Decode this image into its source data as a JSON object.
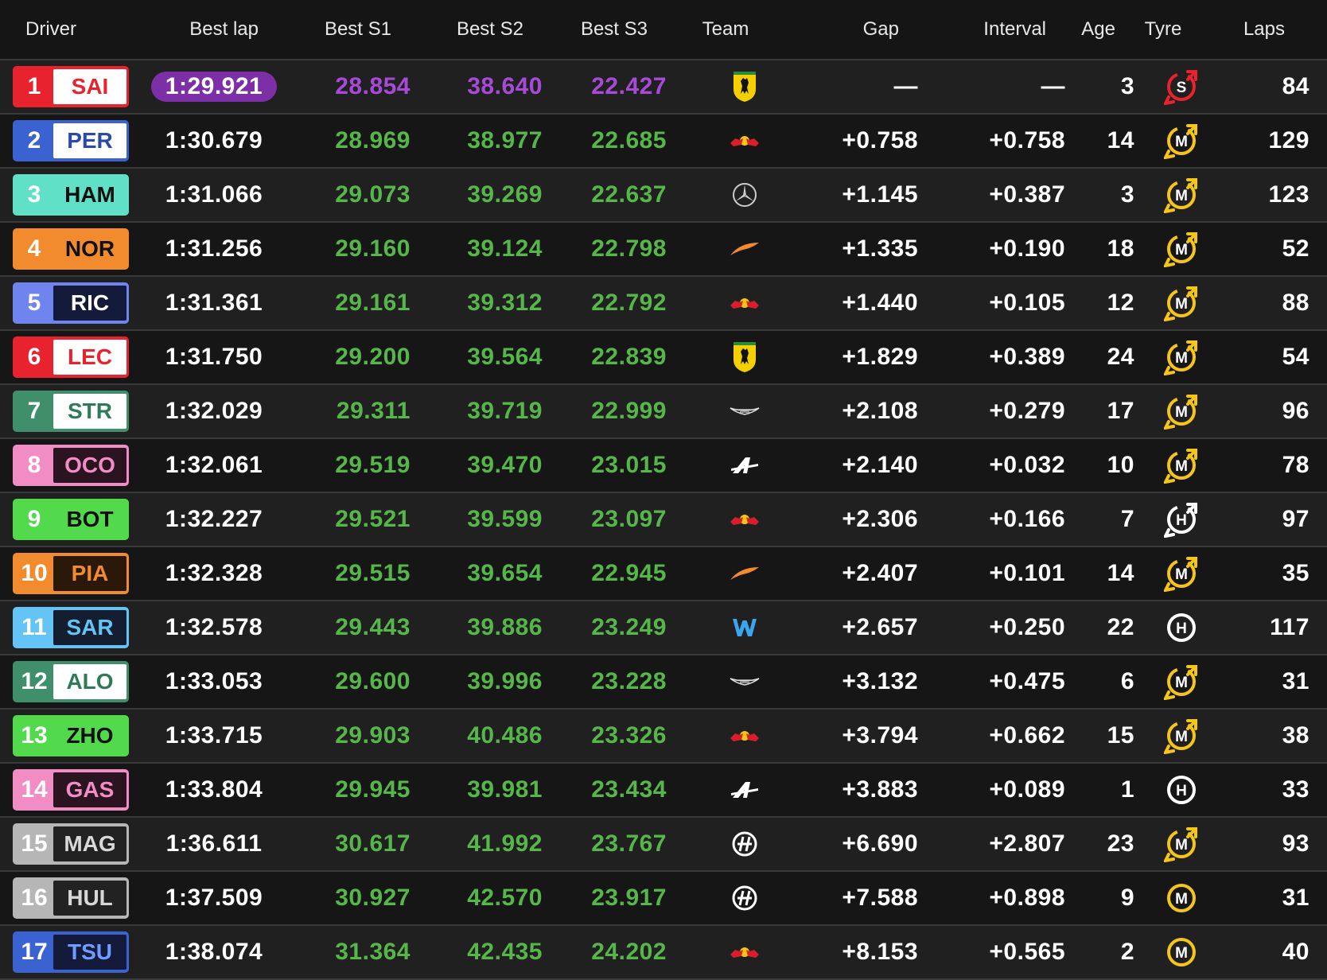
{
  "headers": {
    "driver": "Driver",
    "best_lap": "Best lap",
    "best_s1": "Best S1",
    "best_s2": "Best S2",
    "best_s3": "Best S3",
    "team": "Team",
    "gap": "Gap",
    "interval": "Interval",
    "age": "Age",
    "tyre": "Tyre",
    "laps": "Laps"
  },
  "colors": {
    "purple_sector": "#a84ad8",
    "green_sector": "#56b64a",
    "fastest_lap_pill": "#7d2fa8",
    "soft_tyre": "#e8232d",
    "medium_tyre": "#f5c518",
    "hard_tyre": "#ffffff"
  },
  "rows": [
    {
      "pos": "1",
      "code": "SAI",
      "team": "ferrari-icon",
      "team_color": "#e8232d",
      "code_bg": "#ffffff",
      "code_color": "#e8232d",
      "best_lap": "1:29.921",
      "fastest": true,
      "s1": "28.854",
      "s2": "38.640",
      "s3": "22.427",
      "s1_purple": true,
      "s2_purple": true,
      "s3_purple": true,
      "gap": "—",
      "interval": "—",
      "age": "3",
      "tyre": "S",
      "tyre_icon": "soft-tyre-icon",
      "laps": "84"
    },
    {
      "pos": "2",
      "code": "PER",
      "team": "red-bull-icon",
      "team_color": "#3a62d0",
      "code_bg": "#ffffff",
      "code_color": "#2a4aa8",
      "best_lap": "1:30.679",
      "fastest": false,
      "s1": "28.969",
      "s2": "38.977",
      "s3": "22.685",
      "gap": "+0.758",
      "interval": "+0.758",
      "age": "14",
      "tyre": "M",
      "tyre_icon": "medium-tyre-icon",
      "laps": "129"
    },
    {
      "pos": "3",
      "code": "HAM",
      "team": "mercedes-icon",
      "team_color": "#5fe0c7",
      "code_bg": "#5fe0c7",
      "code_color": "#101010",
      "best_lap": "1:31.066",
      "fastest": false,
      "s1": "29.073",
      "s2": "39.269",
      "s3": "22.637",
      "gap": "+1.145",
      "interval": "+0.387",
      "age": "3",
      "tyre": "M",
      "tyre_icon": "medium-tyre-icon",
      "laps": "123"
    },
    {
      "pos": "4",
      "code": "NOR",
      "team": "mclaren-icon",
      "team_color": "#f28a2e",
      "code_bg": "#f28a2e",
      "code_color": "#101010",
      "best_lap": "1:31.256",
      "fastest": false,
      "s1": "29.160",
      "s2": "39.124",
      "s3": "22.798",
      "gap": "+1.335",
      "interval": "+0.190",
      "age": "18",
      "tyre": "M",
      "tyre_icon": "medium-tyre-icon",
      "laps": "52"
    },
    {
      "pos": "5",
      "code": "RIC",
      "team": "red-bull-icon",
      "team_color": "#6f84ee",
      "code_bg": "#141a3a",
      "code_color": "#ffffff",
      "best_lap": "1:31.361",
      "fastest": false,
      "s1": "29.161",
      "s2": "39.312",
      "s3": "22.792",
      "gap": "+1.440",
      "interval": "+0.105",
      "age": "12",
      "tyre": "M",
      "tyre_icon": "medium-tyre-icon",
      "laps": "88"
    },
    {
      "pos": "6",
      "code": "LEC",
      "team": "ferrari-icon",
      "team_color": "#e8232d",
      "code_bg": "#ffffff",
      "code_color": "#e8232d",
      "best_lap": "1:31.750",
      "fastest": false,
      "s1": "29.200",
      "s2": "39.564",
      "s3": "22.839",
      "gap": "+1.829",
      "interval": "+0.389",
      "age": "24",
      "tyre": "M",
      "tyre_icon": "medium-tyre-icon",
      "laps": "54"
    },
    {
      "pos": "7",
      "code": "STR",
      "team": "aston-martin-icon",
      "team_color": "#3f8f6a",
      "code_bg": "#ffffff",
      "code_color": "#2f7a57",
      "best_lap": "1:32.029",
      "fastest": false,
      "s1": "29.311",
      "s2": "39.719",
      "s3": "22.999",
      "gap": "+2.108",
      "interval": "+0.279",
      "age": "17",
      "tyre": "M",
      "tyre_icon": "medium-tyre-icon",
      "laps": "96"
    },
    {
      "pos": "8",
      "code": "OCO",
      "team": "alpine-icon",
      "team_color": "#f28cc4",
      "code_bg": "#2a1420",
      "code_color": "#f28cc4",
      "best_lap": "1:32.061",
      "fastest": false,
      "s1": "29.519",
      "s2": "39.470",
      "s3": "23.015",
      "gap": "+2.140",
      "interval": "+0.032",
      "age": "10",
      "tyre": "M",
      "tyre_icon": "medium-tyre-icon",
      "laps": "78"
    },
    {
      "pos": "9",
      "code": "BOT",
      "team": "red-bull-icon",
      "team_color": "#52d94c",
      "code_bg": "#52d94c",
      "code_color": "#101010",
      "best_lap": "1:32.227",
      "fastest": false,
      "s1": "29.521",
      "s2": "39.599",
      "s3": "23.097",
      "gap": "+2.306",
      "interval": "+0.166",
      "age": "7",
      "tyre": "H",
      "tyre_icon": "hard-tyre-icon",
      "laps": "97"
    },
    {
      "pos": "10",
      "code": "PIA",
      "team": "mclaren-icon",
      "team_color": "#f28a2e",
      "code_bg": "#2a1808",
      "code_color": "#f28a2e",
      "best_lap": "1:32.328",
      "fastest": false,
      "s1": "29.515",
      "s2": "39.654",
      "s3": "22.945",
      "gap": "+2.407",
      "interval": "+0.101",
      "age": "14",
      "tyre": "M",
      "tyre_icon": "medium-tyre-icon",
      "laps": "35"
    },
    {
      "pos": "11",
      "code": "SAR",
      "team": "williams-icon",
      "team_color": "#64c4f5",
      "code_bg": "#141e30",
      "code_color": "#64c4f5",
      "best_lap": "1:32.578",
      "fastest": false,
      "s1": "29.443",
      "s2": "39.886",
      "s3": "23.249",
      "gap": "+2.657",
      "interval": "+0.250",
      "age": "22",
      "tyre": "H",
      "tyre_icon": "hard-tyre-icon",
      "laps": "117"
    },
    {
      "pos": "12",
      "code": "ALO",
      "team": "aston-martin-icon",
      "team_color": "#3f8f6a",
      "code_bg": "#ffffff",
      "code_color": "#2f7a57",
      "best_lap": "1:33.053",
      "fastest": false,
      "s1": "29.600",
      "s2": "39.996",
      "s3": "23.228",
      "gap": "+3.132",
      "interval": "+0.475",
      "age": "6",
      "tyre": "M",
      "tyre_icon": "medium-tyre-icon",
      "laps": "31"
    },
    {
      "pos": "13",
      "code": "ZHO",
      "team": "red-bull-icon",
      "team_color": "#52d94c",
      "code_bg": "#52d94c",
      "code_color": "#101010",
      "best_lap": "1:33.715",
      "fastest": false,
      "s1": "29.903",
      "s2": "40.486",
      "s3": "23.326",
      "gap": "+3.794",
      "interval": "+0.662",
      "age": "15",
      "tyre": "M",
      "tyre_icon": "medium-tyre-icon",
      "laps": "38"
    },
    {
      "pos": "14",
      "code": "GAS",
      "team": "alpine-icon",
      "team_color": "#f28cc4",
      "code_bg": "#2a1420",
      "code_color": "#f28cc4",
      "best_lap": "1:33.804",
      "fastest": false,
      "s1": "29.945",
      "s2": "39.981",
      "s3": "23.434",
      "gap": "+3.883",
      "interval": "+0.089",
      "age": "1",
      "tyre": "H",
      "tyre_icon": "hard-tyre-icon",
      "laps": "33"
    },
    {
      "pos": "15",
      "code": "MAG",
      "team": "haas-icon",
      "team_color": "#b6b6b6",
      "code_bg": "#222222",
      "code_color": "#d8d8d8",
      "best_lap": "1:36.611",
      "fastest": false,
      "s1": "30.617",
      "s2": "41.992",
      "s3": "23.767",
      "gap": "+6.690",
      "interval": "+2.807",
      "age": "23",
      "tyre": "M",
      "tyre_icon": "medium-tyre-icon",
      "laps": "93"
    },
    {
      "pos": "16",
      "code": "HUL",
      "team": "haas-icon",
      "team_color": "#b6b6b6",
      "code_bg": "#222222",
      "code_color": "#d8d8d8",
      "best_lap": "1:37.509",
      "fastest": false,
      "s1": "30.927",
      "s2": "42.570",
      "s3": "23.917",
      "gap": "+7.588",
      "interval": "+0.898",
      "age": "9",
      "tyre": "M",
      "tyre_icon": "medium-tyre-icon",
      "laps": "31"
    },
    {
      "pos": "17",
      "code": "TSU",
      "team": "red-bull-icon",
      "team_color": "#3a62d0",
      "code_bg": "#141a3a",
      "code_color": "#6f9cff",
      "best_lap": "1:38.074",
      "fastest": false,
      "s1": "31.364",
      "s2": "42.435",
      "s3": "24.202",
      "gap": "+8.153",
      "interval": "+0.565",
      "age": "2",
      "tyre": "M",
      "tyre_icon": "medium-tyre-icon",
      "laps": "40"
    }
  ]
}
